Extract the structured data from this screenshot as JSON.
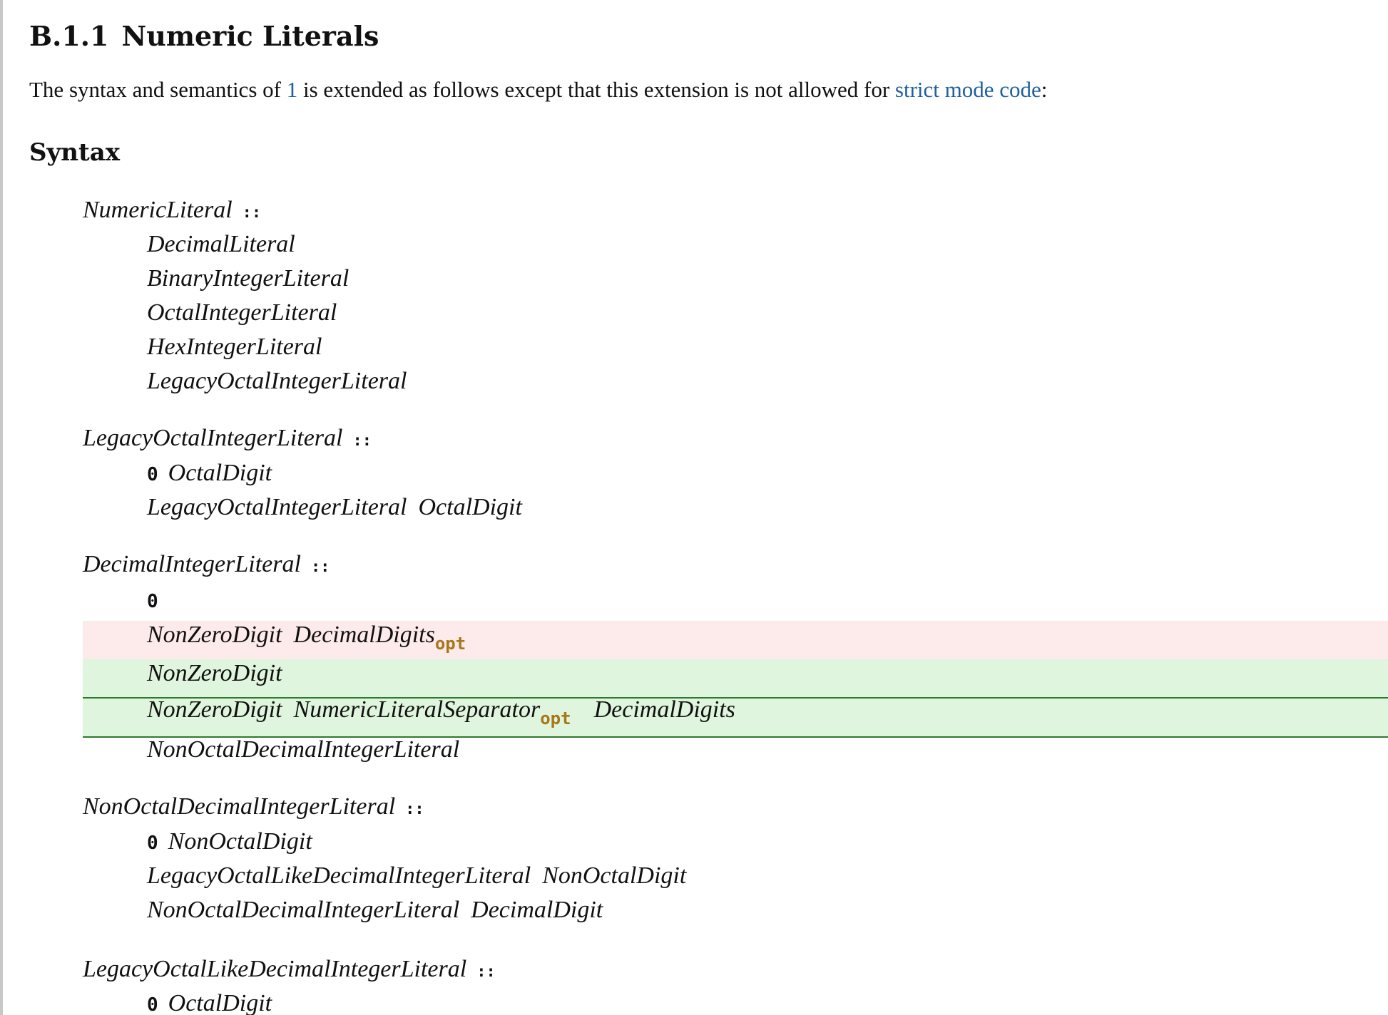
{
  "section": {
    "number": "B.1.1",
    "title": "Numeric Literals"
  },
  "intro": {
    "before": "The syntax and semantics of ",
    "link1": "1",
    "middle": " is extended as follows except that this extension is not allowed for ",
    "link2": "strict mode code",
    "after": ":"
  },
  "syntax_heading": "Syntax",
  "grammar": {
    "geq": "::",
    "opt": "opt",
    "numeric_literal": {
      "lhs": "NumericLiteral",
      "alts": [
        "DecimalLiteral",
        "BinaryIntegerLiteral",
        "OctalIntegerLiteral",
        "HexIntegerLiteral",
        "LegacyOctalIntegerLiteral"
      ]
    },
    "legacy_octal_integer_literal": {
      "lhs": "LegacyOctalIntegerLiteral",
      "alt1_term": "0",
      "alt1_nt": "OctalDigit",
      "alt2_nt1": "LegacyOctalIntegerLiteral",
      "alt2_nt2": "OctalDigit"
    },
    "decimal_integer_literal": {
      "lhs": "DecimalIntegerLiteral",
      "alt1_term": "0",
      "deleted_nt1": "NonZeroDigit",
      "deleted_nt2": "DecimalDigits",
      "inserted1_nt": "NonZeroDigit",
      "inserted2_nt1": "NonZeroDigit",
      "inserted2_nt2": "NumericLiteralSeparator",
      "inserted2_nt3": "DecimalDigits",
      "alt_last": "NonOctalDecimalIntegerLiteral"
    },
    "non_octal_decimal_integer_literal": {
      "lhs": "NonOctalDecimalIntegerLiteral",
      "alt1_term": "0",
      "alt1_nt": "NonOctalDigit",
      "alt2_nt1": "LegacyOctalLikeDecimalIntegerLiteral",
      "alt2_nt2": "NonOctalDigit",
      "alt3_nt1": "NonOctalDecimalIntegerLiteral",
      "alt3_nt2": "DecimalDigit"
    },
    "legacy_octal_like_decimal_integer_literal": {
      "lhs": "LegacyOctalLikeDecimalIntegerLiteral",
      "alt1_term": "0",
      "alt1_nt": "OctalDigit"
    }
  },
  "colors": {
    "link": "#1f5fa0",
    "deleted_bg": "#fdeaea",
    "inserted_bg": "#e0f5de",
    "inserted_border": "#2c7a2c",
    "opt": "#a7781a"
  }
}
